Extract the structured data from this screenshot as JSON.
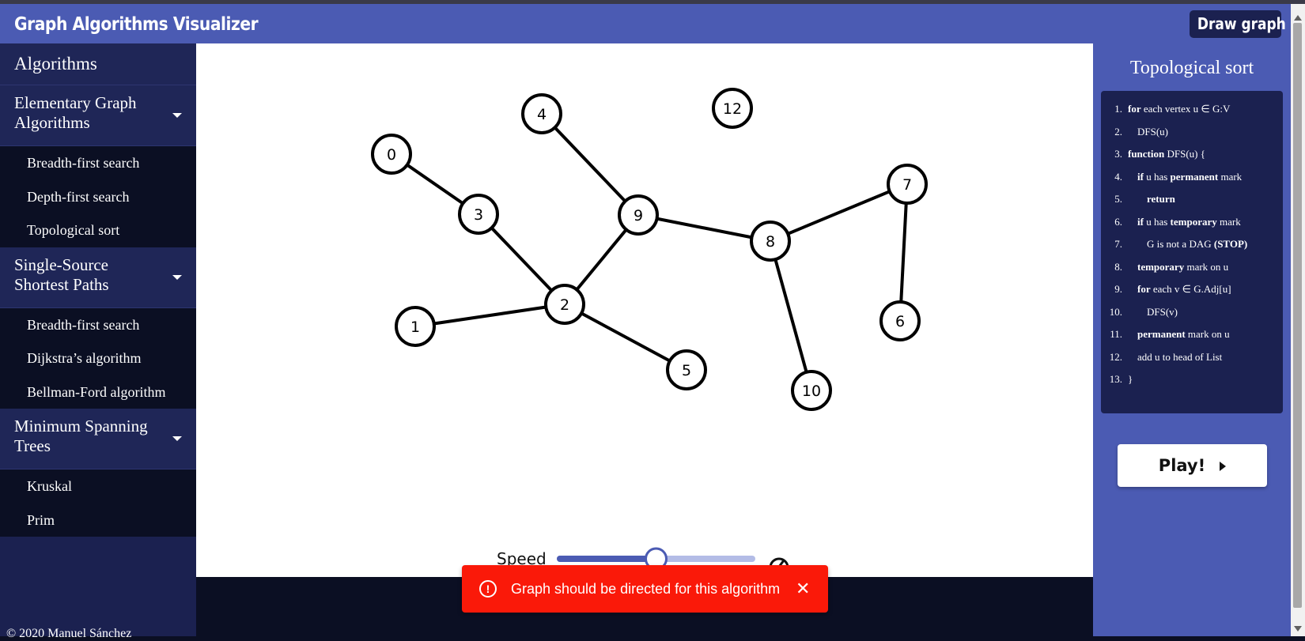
{
  "app": {
    "title": "Graph Algorithms Visualizer",
    "draw_button": "Draw graph"
  },
  "sidebar": {
    "header": "Algorithms",
    "sections": [
      {
        "title": "Elementary Graph Algorithms",
        "items": [
          "Breadth-first search",
          "Depth-first search",
          "Topological sort"
        ]
      },
      {
        "title": "Single-Source Shortest Paths",
        "items": [
          "Breadth-first search",
          "Dijkstra’s algorithm",
          "Bellman-Ford algorithm"
        ]
      },
      {
        "title": "Minimum Spanning Trees",
        "items": [
          "Kruskal",
          "Prim"
        ]
      }
    ],
    "footer": "© 2020 Manuel Sánchez"
  },
  "graph": {
    "nodes": [
      "0",
      "1",
      "2",
      "3",
      "4",
      "5",
      "6",
      "7",
      "8",
      "9",
      "10",
      "12"
    ],
    "edges": [
      [
        "0",
        "3"
      ],
      [
        "3",
        "2"
      ],
      [
        "4",
        "9"
      ],
      [
        "9",
        "2"
      ],
      [
        "1",
        "2"
      ],
      [
        "2",
        "5"
      ],
      [
        "9",
        "8"
      ],
      [
        "8",
        "7"
      ],
      [
        "7",
        "6"
      ],
      [
        "8",
        "10"
      ]
    ]
  },
  "controls": {
    "speed_label": "Speed",
    "speed_value": 0.5
  },
  "panel": {
    "title": "Topological sort",
    "code": [
      {
        "num": "1.",
        "parts": [
          [
            "for",
            true
          ],
          [
            " each vertex u ∈ G:V",
            false
          ]
        ]
      },
      {
        "num": "2.",
        "parts": [
          [
            "DFS(u)",
            false
          ]
        ]
      },
      {
        "num": "3.",
        "parts": [
          [
            "function",
            true
          ],
          [
            " DFS(u) {",
            false
          ]
        ]
      },
      {
        "num": "4.",
        "parts": [
          [
            "if",
            true
          ],
          [
            " u has ",
            false
          ],
          [
            "permanent",
            true
          ],
          [
            " mark",
            false
          ]
        ]
      },
      {
        "num": "5.",
        "parts": [
          [
            "return",
            true
          ]
        ]
      },
      {
        "num": "6.",
        "parts": [
          [
            "if",
            true
          ],
          [
            " u has ",
            false
          ],
          [
            "temporary",
            true
          ],
          [
            " mark",
            false
          ]
        ]
      },
      {
        "num": "7.",
        "parts": [
          [
            "G is not a DAG ",
            false
          ],
          [
            "(STOP)",
            true
          ]
        ]
      },
      {
        "num": "8.",
        "parts": [
          [
            "temporary",
            true
          ],
          [
            " mark on u",
            false
          ]
        ]
      },
      {
        "num": "9.",
        "parts": [
          [
            "for",
            true
          ],
          [
            " each v ∈ G.Adj[u]",
            false
          ]
        ]
      },
      {
        "num": "10.",
        "parts": [
          [
            "DFS(v)",
            false
          ]
        ]
      },
      {
        "num": "11.",
        "parts": [
          [
            "permanent",
            true
          ],
          [
            " mark on u",
            false
          ]
        ]
      },
      {
        "num": "12.",
        "parts": [
          [
            "add u to head of List",
            false
          ]
        ]
      },
      {
        "num": "13.",
        "parts": [
          [
            "}",
            false
          ]
        ]
      }
    ],
    "play_button": "Play!"
  },
  "snackbar": {
    "message": "Graph should be directed for this algorithm",
    "icon": "error-icon",
    "close_icon": "close-icon"
  },
  "colors": {
    "appbar": "#4b5bb3",
    "sidebar": "#1b2150",
    "dark": "#0b0f23",
    "error": "#fa1909"
  }
}
